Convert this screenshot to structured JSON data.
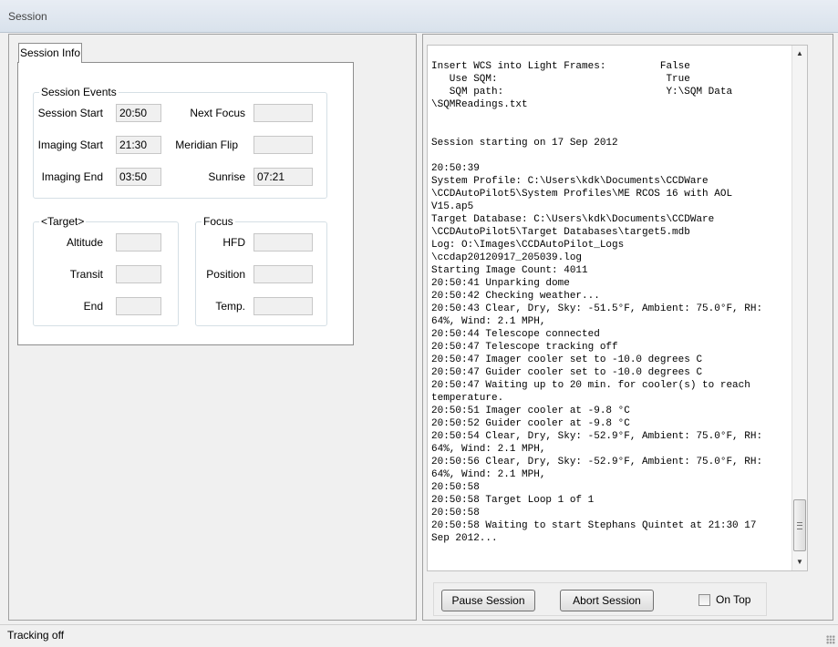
{
  "window": {
    "title": "Session"
  },
  "tab": {
    "label": "Session Info"
  },
  "session_events": {
    "legend": "Session Events",
    "session_start": {
      "label": "Session Start",
      "value": "20:50"
    },
    "imaging_start": {
      "label": "Imaging Start",
      "value": "21:30"
    },
    "imaging_end": {
      "label": "Imaging End",
      "value": "03:50"
    },
    "next_focus": {
      "label": "Next Focus",
      "value": ""
    },
    "meridian_flip": {
      "label": "Meridian Flip",
      "value": ""
    },
    "sunrise": {
      "label": "Sunrise",
      "value": "07:21"
    }
  },
  "target": {
    "legend": "<Target>",
    "altitude": {
      "label": "Altitude",
      "value": ""
    },
    "transit": {
      "label": "Transit",
      "value": ""
    },
    "end": {
      "label": "End",
      "value": ""
    }
  },
  "focus": {
    "legend": "Focus",
    "hfd": {
      "label": "HFD",
      "value": ""
    },
    "position": {
      "label": "Position",
      "value": ""
    },
    "temp": {
      "label": "Temp.",
      "value": ""
    }
  },
  "log": {
    "lines": [
      "Insert WCS into Light Frames:         False",
      "   Use SQM:                            True",
      "   SQM path:                           Y:\\SQM Data",
      "\\SQMReadings.txt",
      "",
      "",
      "Session starting on 17 Sep 2012",
      "",
      "20:50:39",
      "System Profile: C:\\Users\\kdk\\Documents\\CCDWare",
      "\\CCDAutoPilot5\\System Profiles\\ME RCOS 16 with AOL",
      "V15.ap5",
      "Target Database: C:\\Users\\kdk\\Documents\\CCDWare",
      "\\CCDAutoPilot5\\Target Databases\\target5.mdb",
      "Log: O:\\Images\\CCDAutoPilot_Logs",
      "\\ccdap20120917_205039.log",
      "Starting Image Count: 4011",
      "20:50:41 Unparking dome",
      "20:50:42 Checking weather...",
      "20:50:43 Clear, Dry, Sky: -51.5°F, Ambient: 75.0°F, RH:",
      "64%, Wind: 2.1 MPH,",
      "20:50:44 Telescope connected",
      "20:50:47 Telescope tracking off",
      "20:50:47 Imager cooler set to -10.0 degrees C",
      "20:50:47 Guider cooler set to -10.0 degrees C",
      "20:50:47 Waiting up to 20 min. for cooler(s) to reach",
      "temperature.",
      "20:50:51 Imager cooler at -9.8 °C",
      "20:50:52 Guider cooler at -9.8 °C",
      "20:50:54 Clear, Dry, Sky: -52.9°F, Ambient: 75.0°F, RH:",
      "64%, Wind: 2.1 MPH,",
      "20:50:56 Clear, Dry, Sky: -52.9°F, Ambient: 75.0°F, RH:",
      "64%, Wind: 2.1 MPH,",
      "20:50:58",
      "20:50:58 Target Loop 1 of 1",
      "20:50:58",
      "20:50:58 Waiting to start Stephans Quintet at 21:30 17",
      "Sep 2012..."
    ]
  },
  "buttons": {
    "pause": "Pause Session",
    "abort": "Abort Session"
  },
  "on_top": {
    "label": "On Top",
    "checked": false
  },
  "status": {
    "text": "Tracking off"
  },
  "icons": {
    "scroll_up": "up-arrow-icon",
    "scroll_down": "down-arrow-icon",
    "size_grip": "resize-grip-icon"
  }
}
